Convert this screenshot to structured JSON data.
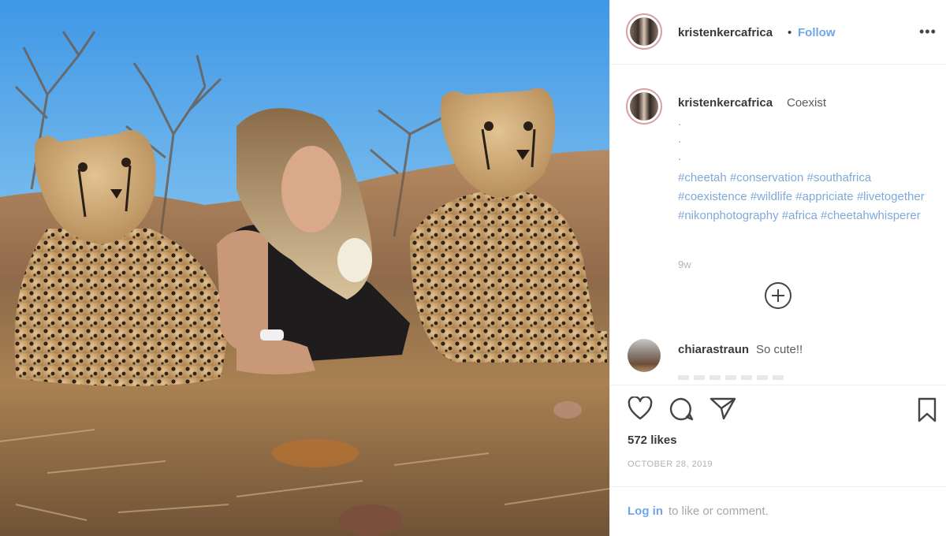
{
  "header": {
    "username": "kristenkercafrica",
    "separator": "•",
    "follow_label": "Follow",
    "more_label": "•••"
  },
  "caption": {
    "username": "kristenkercafrica",
    "text": "Coexist",
    "dots": [
      ".",
      ".",
      "."
    ],
    "hashtags": [
      "#cheetah",
      "#conservation",
      "#southafrica",
      "#coexistence",
      "#wildlife",
      "#appriciate",
      "#livetogether",
      "#nikonphotography",
      "#africa",
      "#cheetahwhisperer"
    ],
    "age": "9w"
  },
  "comments": [
    {
      "username": "chiarastraun",
      "text": "So cute!!"
    }
  ],
  "actions": {
    "icons": [
      "heart-icon",
      "comment-icon",
      "share-icon",
      "bookmark-icon"
    ]
  },
  "stats": {
    "likes": "572 likes",
    "date": "OCTOBER 28, 2019"
  },
  "footer": {
    "login_label": "Log in",
    "login_rest": "to like or comment."
  },
  "colors": {
    "link": "#6fa6e8",
    "hashtag": "#7fa9d8",
    "avatar_ring": "#d7a1a6"
  }
}
